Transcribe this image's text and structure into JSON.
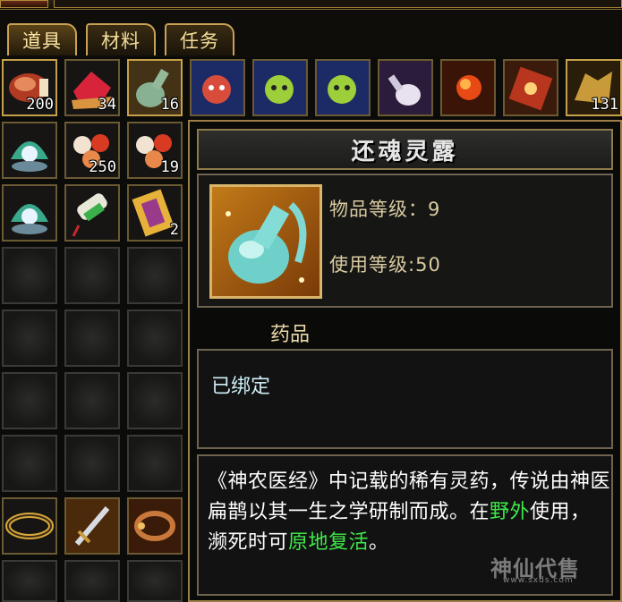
{
  "tabs": [
    {
      "label": "道具",
      "active": true
    },
    {
      "label": "材料",
      "active": false
    },
    {
      "label": "任务",
      "active": false
    }
  ],
  "inventory": {
    "row1": [
      {
        "icon": "meat-icon",
        "qty": "200"
      },
      {
        "icon": "red-crystal-icon",
        "qty": "34"
      },
      {
        "icon": "elixir-flask-icon",
        "qty": "16"
      },
      {
        "icon": "red-spirit-doll-icon",
        "qty": ""
      },
      {
        "icon": "green-spirit-doll-icon",
        "qty": ""
      },
      {
        "icon": "green-spirit-doll-icon",
        "qty": ""
      },
      {
        "icon": "white-gourd-icon",
        "qty": ""
      },
      {
        "icon": "fire-orb-icon",
        "qty": ""
      },
      {
        "icon": "red-scroll-box-icon",
        "qty": ""
      },
      {
        "icon": "gold-beast-icon",
        "qty": "131"
      }
    ],
    "row2": [
      {
        "icon": "pearl-shell-icon",
        "qty": ""
      },
      {
        "icon": "red-pills-icon",
        "qty": "250"
      },
      {
        "icon": "red-pills-icon",
        "qty": "19"
      }
    ],
    "row3": [
      {
        "icon": "pearl-shell-icon",
        "qty": ""
      },
      {
        "icon": "jade-talisman-icon",
        "qty": ""
      },
      {
        "icon": "gold-card-icon",
        "qty": "2"
      }
    ],
    "bottom_row": [
      {
        "icon": "gold-ring-icon",
        "qty": ""
      },
      {
        "icon": "sword-icon",
        "qty": ""
      },
      {
        "icon": "bracelet-icon",
        "qty": ""
      }
    ]
  },
  "tooltip": {
    "name": "还魂灵露",
    "item_level_label": "物品等级：",
    "item_level": "9",
    "use_level_label": "使用等级:",
    "use_level": "50",
    "category": "药品",
    "bound_status": "已绑定",
    "description_part1": "《神农医经》中记载的稀有灵药，传说由神医扁鹊以其一生之学研制而成。在",
    "description_hl1": "野外",
    "description_part2": "使用，濒死时可",
    "description_hl2": "原地复活",
    "description_end": "。"
  },
  "watermark": {
    "text": "神仙代售",
    "url": "www.sxds.com"
  },
  "colors": {
    "gold_border": "#c9a255",
    "highlight_green": "#3fe84b",
    "bound_text": "#cfeef6"
  }
}
